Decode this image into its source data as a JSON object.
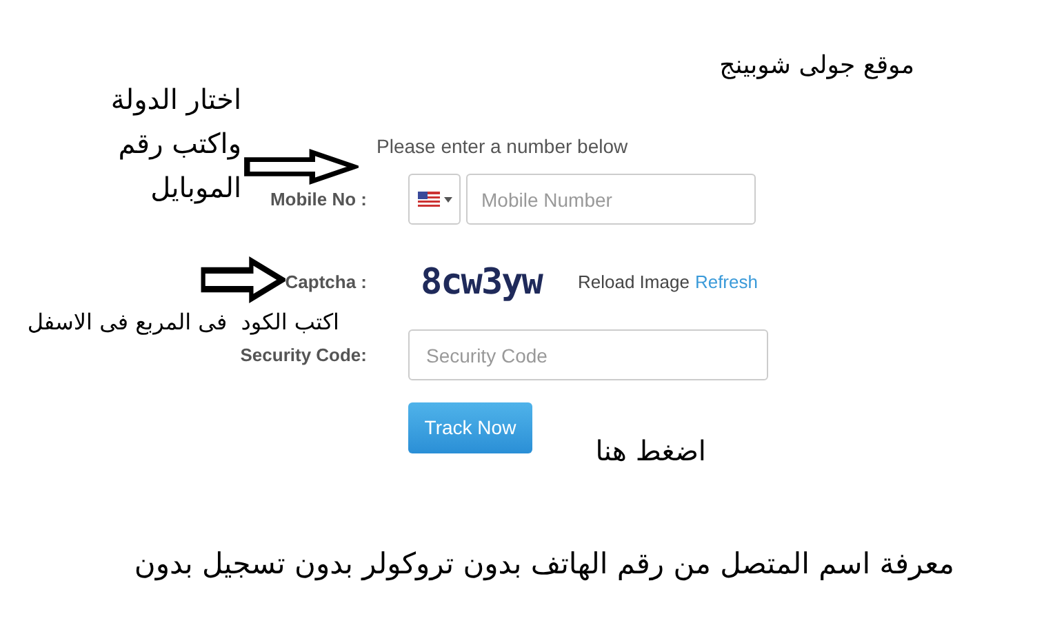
{
  "page_title": "موقع جولى شوبينج",
  "note_country": [
    "اختار الدولة",
    "واكتب رقم",
    "الموبايل"
  ],
  "form": {
    "prompt": "Please enter a number below",
    "mobile_label": "Mobile No :",
    "mobile_placeholder": "Mobile Number",
    "captcha_label": "Captcha :",
    "captcha_text": "8cw3yw",
    "reload_label": "Reload Image",
    "refresh_link": "Refresh",
    "security_label": "Security Code:",
    "security_placeholder": "Security Code",
    "button": "Track Now"
  },
  "note_code": "اكتب الكود  فى المربع فى الاسفل",
  "note_click": "اضغط هنا",
  "footer_text": "معرفة اسم المتصل من رقم الهاتف بدون تروكولر بدون تسجيل بدون"
}
